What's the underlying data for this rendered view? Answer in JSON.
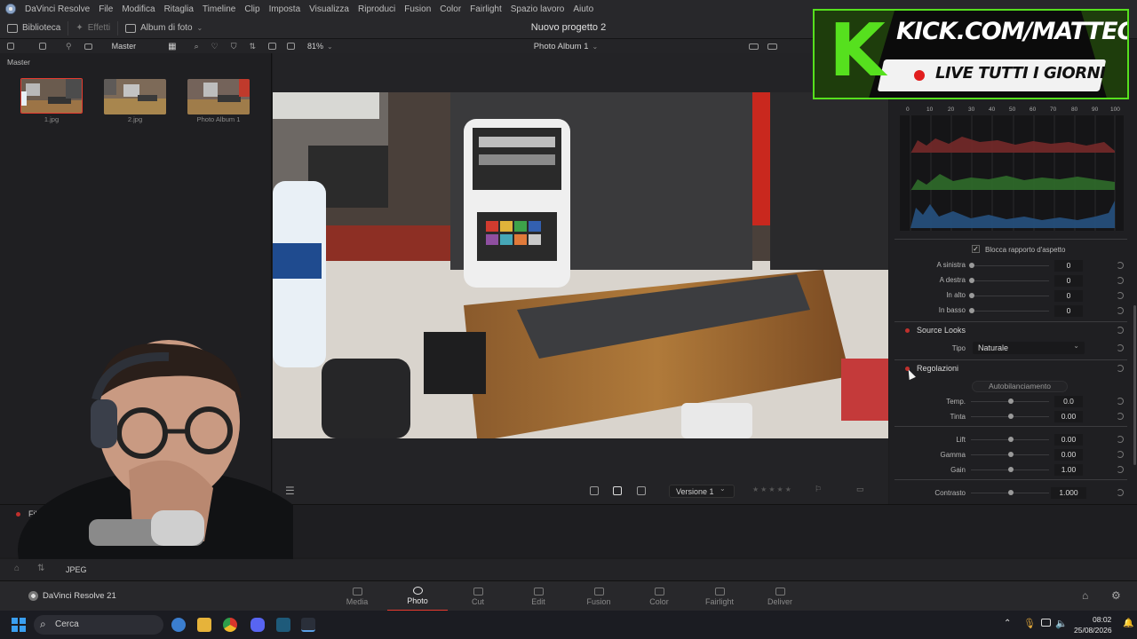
{
  "app": {
    "name": "DaVinci Resolve",
    "menu": [
      "File",
      "Modifica",
      "Ritaglia",
      "Timeline",
      "Clip",
      "Imposta",
      "Visualizza",
      "Riproduci",
      "Fusion",
      "Color",
      "Fairlight",
      "Spazio lavoro",
      "Aiuto"
    ],
    "project_title": "Nuovo progetto 2"
  },
  "toolbar": {
    "library": "Biblioteca",
    "effects": "Effetti",
    "album": "Album di foto",
    "bin_label": "Master",
    "zoom": "81%",
    "album_selector": "Photo Album 1"
  },
  "library": {
    "section": "Master",
    "items": [
      {
        "label": "1.jpg",
        "selected": true
      },
      {
        "label": "2.jpg",
        "selected": false
      },
      {
        "label": "Photo Album 1",
        "selected": false
      }
    ]
  },
  "viewer": {
    "version": "Versione 1"
  },
  "histogram": {
    "ticks": [
      "0",
      "10",
      "20",
      "30",
      "40",
      "50",
      "60",
      "70",
      "80",
      "90",
      "100"
    ]
  },
  "inspector": {
    "lock_aspect": "Blocca rapporto d'aspetto",
    "crop": [
      {
        "label": "A sinistra",
        "value": "0"
      },
      {
        "label": "A destra",
        "value": "0"
      },
      {
        "label": "In alto",
        "value": "0"
      },
      {
        "label": "In basso",
        "value": "0"
      }
    ],
    "source_looks": {
      "title": "Source Looks",
      "type_label": "Tipo",
      "type_value": "Naturale"
    },
    "adjustments": {
      "title": "Regolazioni",
      "auto_balance": "Autobilanciamento",
      "rows": [
        {
          "label": "Temp.",
          "value": "0.0"
        },
        {
          "label": "Tinta",
          "value": "0.00"
        },
        {
          "label": "Lift",
          "value": "0.00"
        },
        {
          "label": "Gamma",
          "value": "0.00"
        },
        {
          "label": "Gain",
          "value": "1.00"
        },
        {
          "label": "Contrasto",
          "value": "1.000"
        }
      ]
    }
  },
  "lower_strip": {
    "filter": "Filt",
    "format": "JPEG"
  },
  "pages": {
    "brand": "DaVinci Resolve 21",
    "items": [
      {
        "label": "Media",
        "active": false
      },
      {
        "label": "Photo",
        "active": true
      },
      {
        "label": "Cut",
        "active": false
      },
      {
        "label": "Edit",
        "active": false
      },
      {
        "label": "Fusion",
        "active": false
      },
      {
        "label": "Color",
        "active": false
      },
      {
        "label": "Fairlight",
        "active": false
      },
      {
        "label": "Deliver",
        "active": false
      }
    ]
  },
  "overlay": {
    "kick_url": "KICK.COM/MATTEOHS",
    "kick_live": "LIVE TUTTI I GIORNI",
    "kick_letter": "K"
  },
  "taskbar": {
    "search": "Cerca",
    "time": "08:02",
    "date": "25/08/2026"
  },
  "colors": {
    "accent_red": "#e83b2f",
    "kick_green": "#56e01e"
  }
}
